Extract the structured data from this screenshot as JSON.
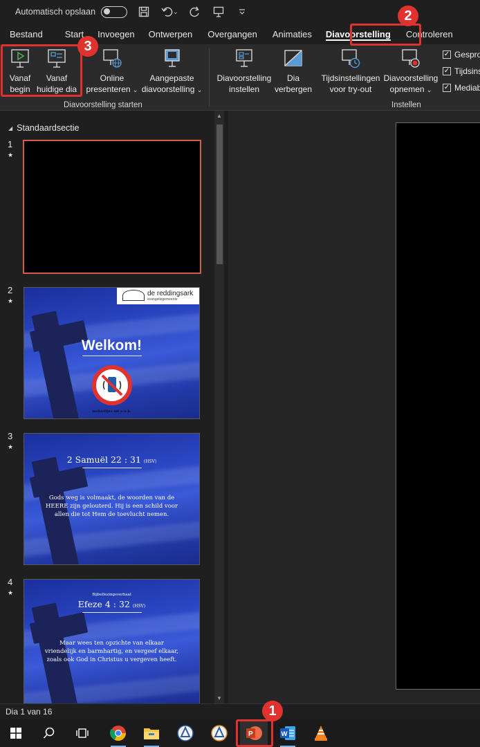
{
  "titlebar": {
    "autosave_label": "Automatisch opslaan",
    "icons": [
      "save-icon",
      "undo-icon",
      "redo-icon",
      "present-icon",
      "customize-icon"
    ]
  },
  "tabs": [
    "Bestand",
    "Start",
    "Invoegen",
    "Ontwerpen",
    "Overgangen",
    "Animaties",
    "Diavoorstelling",
    "Controleren"
  ],
  "active_tab": "Diavoorstelling",
  "ribbon": {
    "from_beginning": [
      "Vanaf",
      "begin"
    ],
    "from_current": [
      "Vanaf",
      "huidige dia"
    ],
    "online": [
      "Online",
      "presenteren"
    ],
    "custom": [
      "Aangepaste",
      "diavoorstelling"
    ],
    "setup": [
      "Diavoorstelling",
      "instellen"
    ],
    "hide": [
      "Dia",
      "verbergen"
    ],
    "rehearse": [
      "Tijdsinstellingen",
      "voor try-out"
    ],
    "record": [
      "Diavoorstelling",
      "opnemen"
    ],
    "group_start": "Diavoorstelling starten",
    "group_setup": "Instellen",
    "checks": [
      "Gespro",
      "Tijdsins",
      "Mediab"
    ]
  },
  "thumbnails": {
    "section": "Standaardsectie",
    "slides": [
      {
        "num": "1",
        "star": "★"
      },
      {
        "num": "2",
        "star": "★",
        "logo": "de reddingsark",
        "logo_sub": "evangeliegemeente",
        "title": "Welkom!",
        "footer": "mobieltjes uit a.u.b."
      },
      {
        "num": "3",
        "star": "★",
        "title": "2 Samuël 22 : 31",
        "version": "(HSV)",
        "body": "Gods weg is volmaakt, de woorden van de HEERE zijn gelouterd. Hij is een schild voor allen die tot Hem de toevlucht nemen."
      },
      {
        "num": "4",
        "star": "★",
        "kicker": "Bijbellezingsverhaal",
        "title": "Efeze 4 : 32",
        "version": "(HSV)",
        "body": "Maar wees ten opzichte van elkaar vriendelijk en barmhartig, en vergeef elkaar, zoals ook God in Christus u vergeven heeft."
      }
    ]
  },
  "status": {
    "slide_indicator": "Dia 1 van 16"
  },
  "taskbar": [
    "windows-icon",
    "search-icon",
    "task-view-icon",
    "chrome-icon",
    "file-explorer-icon",
    "app-icon-1",
    "app-icon-2",
    "powerpoint-icon",
    "word-icon",
    "vlc-icon"
  ],
  "callouts": [
    "1",
    "2",
    "3"
  ],
  "colors": {
    "accent": "#e0322f",
    "selection": "#d95b43",
    "ribbon_bg": "#2b2b2b",
    "window_bg": "#1f1f1f"
  }
}
